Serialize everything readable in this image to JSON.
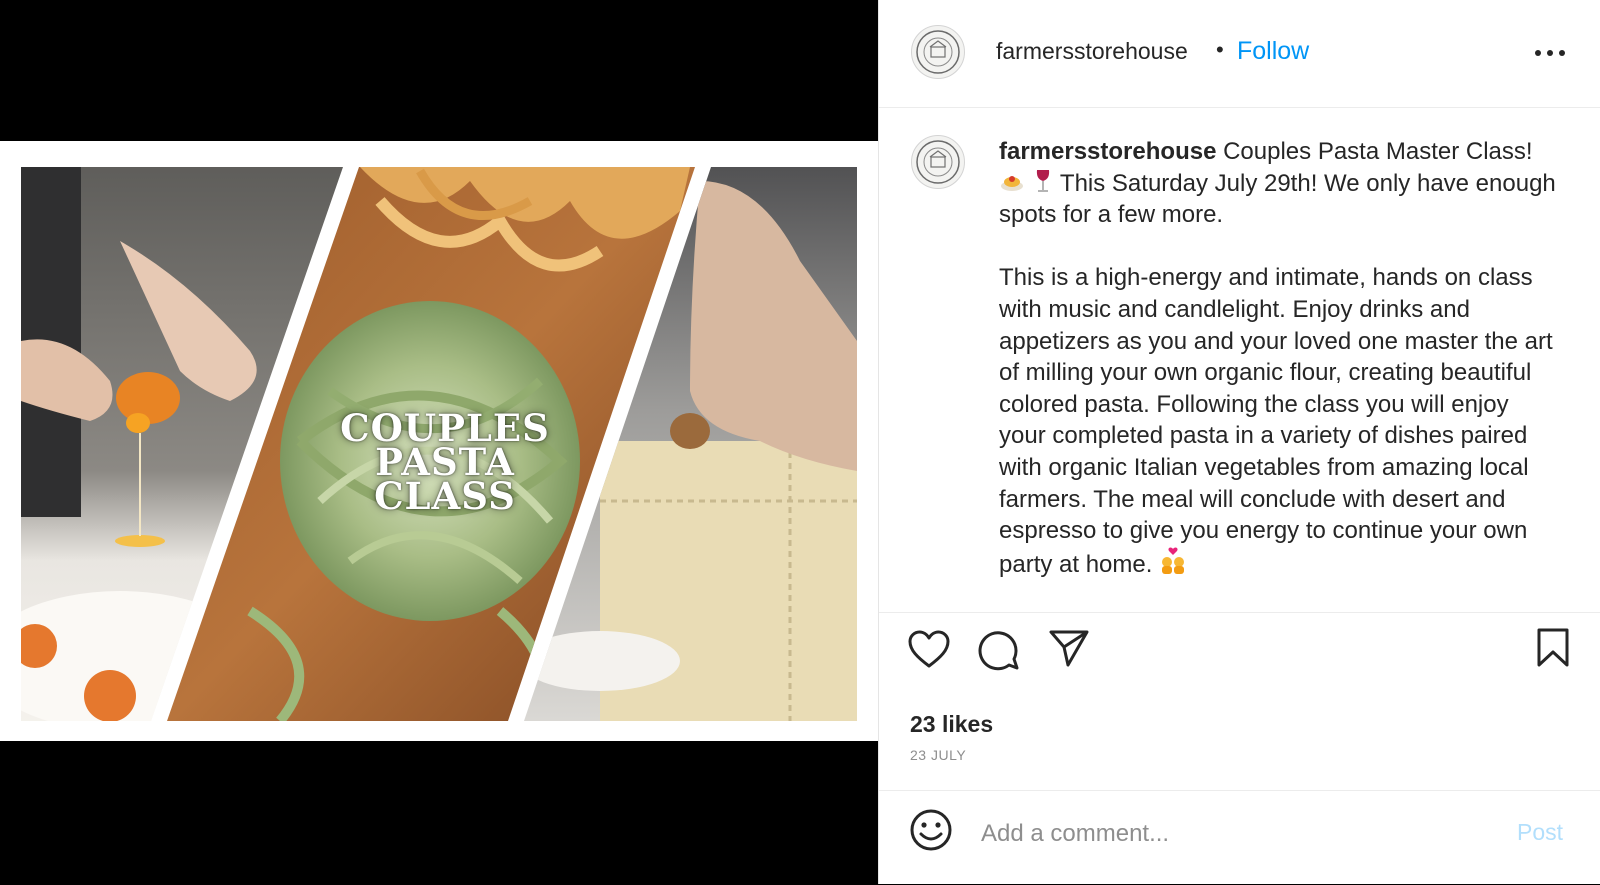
{
  "post_image": {
    "title_line1": "COUPLES",
    "title_line2": "PASTA CLASS"
  },
  "header": {
    "username": "farmersstorehouse",
    "separator": "•",
    "follow_label": "Follow",
    "more_icon": "more-horizontal-icon"
  },
  "caption": {
    "username": "farmersstorehouse",
    "line1": "Couples Pasta Master Class!",
    "line1_rest": " This Saturday July 29th! We only have enough spots for a few more.",
    "body": "This is a high-energy and intimate, hands on class with music and candlelight. Enjoy drinks and appetizers as you and your loved one master the art of milling your own organic flour, creating beautiful colored pasta. Following the class you will enjoy your completed pasta in a variety of dishes paired with organic Italian vegetables from amazing local farmers. The meal will conclude with desert and espresso to give you energy to continue your own party at home.",
    "emojis": [
      "spaghetti-emoji",
      "wine-glass-emoji",
      "couple-heart-emoji"
    ]
  },
  "actions": {
    "icons": [
      "heart-icon",
      "comment-icon",
      "share-icon",
      "bookmark-icon"
    ],
    "likes": "23 likes",
    "date": "23 JULY"
  },
  "comment": {
    "placeholder": "Add a comment...",
    "post_label": "Post"
  },
  "colors": {
    "accent": "#0095f6",
    "post_disabled": "#b2dffc",
    "text": "#262626",
    "muted": "#8e8e8e"
  }
}
